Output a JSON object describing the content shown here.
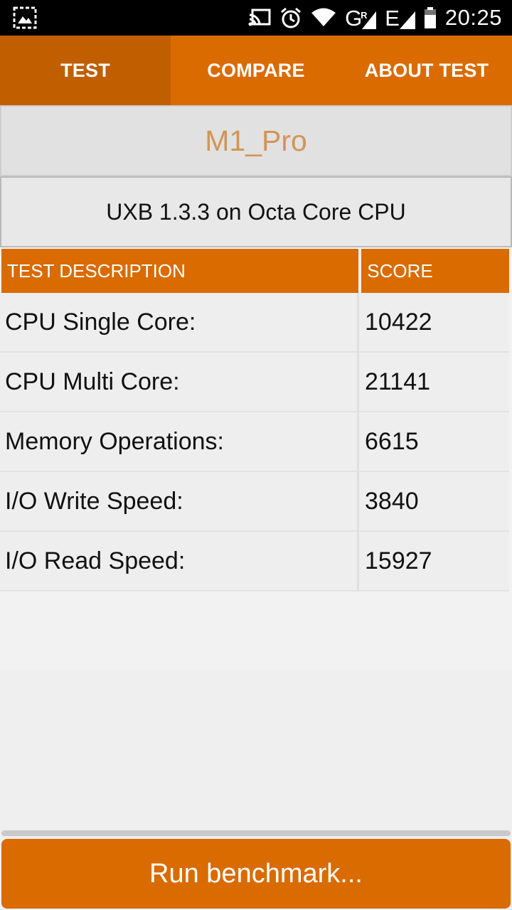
{
  "status_bar": {
    "network": "G",
    "network_sup": "R",
    "network2": "E",
    "time": "20:25",
    "icons": [
      "screenshot-icon",
      "cast-icon",
      "alarm-icon",
      "wifi-icon",
      "signal-icon",
      "signal-icon-2",
      "battery-icon"
    ]
  },
  "tabs": [
    {
      "label": "TEST",
      "active": true
    },
    {
      "label": "COMPARE",
      "active": false
    },
    {
      "label": "ABOUT TEST",
      "active": false
    }
  ],
  "device_name": "M1_Pro",
  "benchmark_info": "UXB 1.3.3 on Octa Core CPU",
  "table": {
    "headers": [
      "TEST DESCRIPTION",
      "SCORE"
    ],
    "rows": [
      {
        "description": "CPU Single Core:",
        "score": "10422"
      },
      {
        "description": "CPU Multi Core:",
        "score": "21141"
      },
      {
        "description": "Memory Operations:",
        "score": "6615"
      },
      {
        "description": "I/O Write Speed:",
        "score": "3840"
      },
      {
        "description": "I/O Read Speed:",
        "score": "15927"
      }
    ]
  },
  "run_button_label": "Run benchmark...",
  "colors": {
    "accent": "#d96b00",
    "tab_active": "#c05e00",
    "device_name": "#d29555"
  }
}
